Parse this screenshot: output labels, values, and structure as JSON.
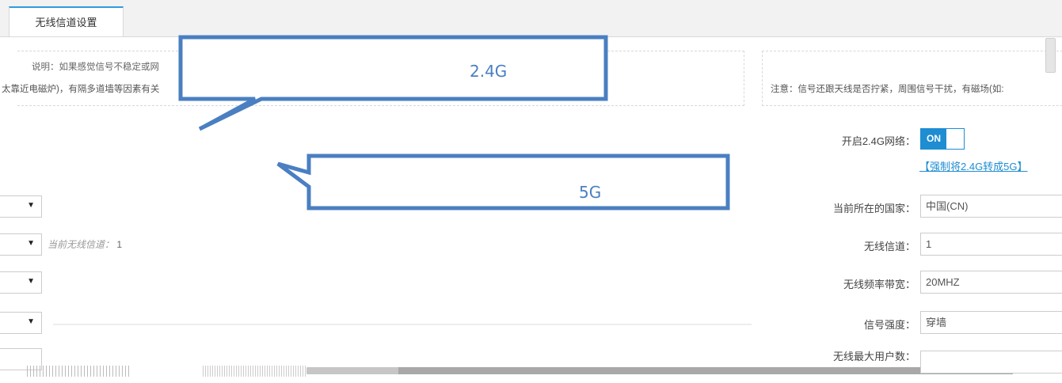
{
  "tab": {
    "label": "无线信道设置"
  },
  "notice": {
    "top_text": "说明：如果感觉信号不稳定或网",
    "left_text": "太靠近电磁炉)，有隔多道墙等因素有关",
    "right_text": "注意：信号还跟天线是否拧紧，周围信号干扰，有磁场(如:"
  },
  "callouts": {
    "label_24g": "2.4G",
    "label_5g": "5G"
  },
  "left_column": {
    "arrow": "▼",
    "hint_label": "当前无线信道：",
    "hint_value": "1"
  },
  "form": {
    "enable_24g_label": "开启2.4G网络：",
    "toggle_on_label": "ON",
    "force_link": "【强制将2.4G转成5G】",
    "country_label": "当前所在的国家：",
    "country_value": "中国(CN)",
    "channel_label": "无线信道：",
    "channel_value": "1",
    "bandwidth_label": "无线频率带宽：",
    "bandwidth_value": "20MHZ",
    "strength_label": "信号强度：",
    "strength_value": "穿墙",
    "max_users_label": "无线最大用户数："
  },
  "colors": {
    "accent": "#1e8dd2",
    "callout": "#4a7fc1"
  }
}
